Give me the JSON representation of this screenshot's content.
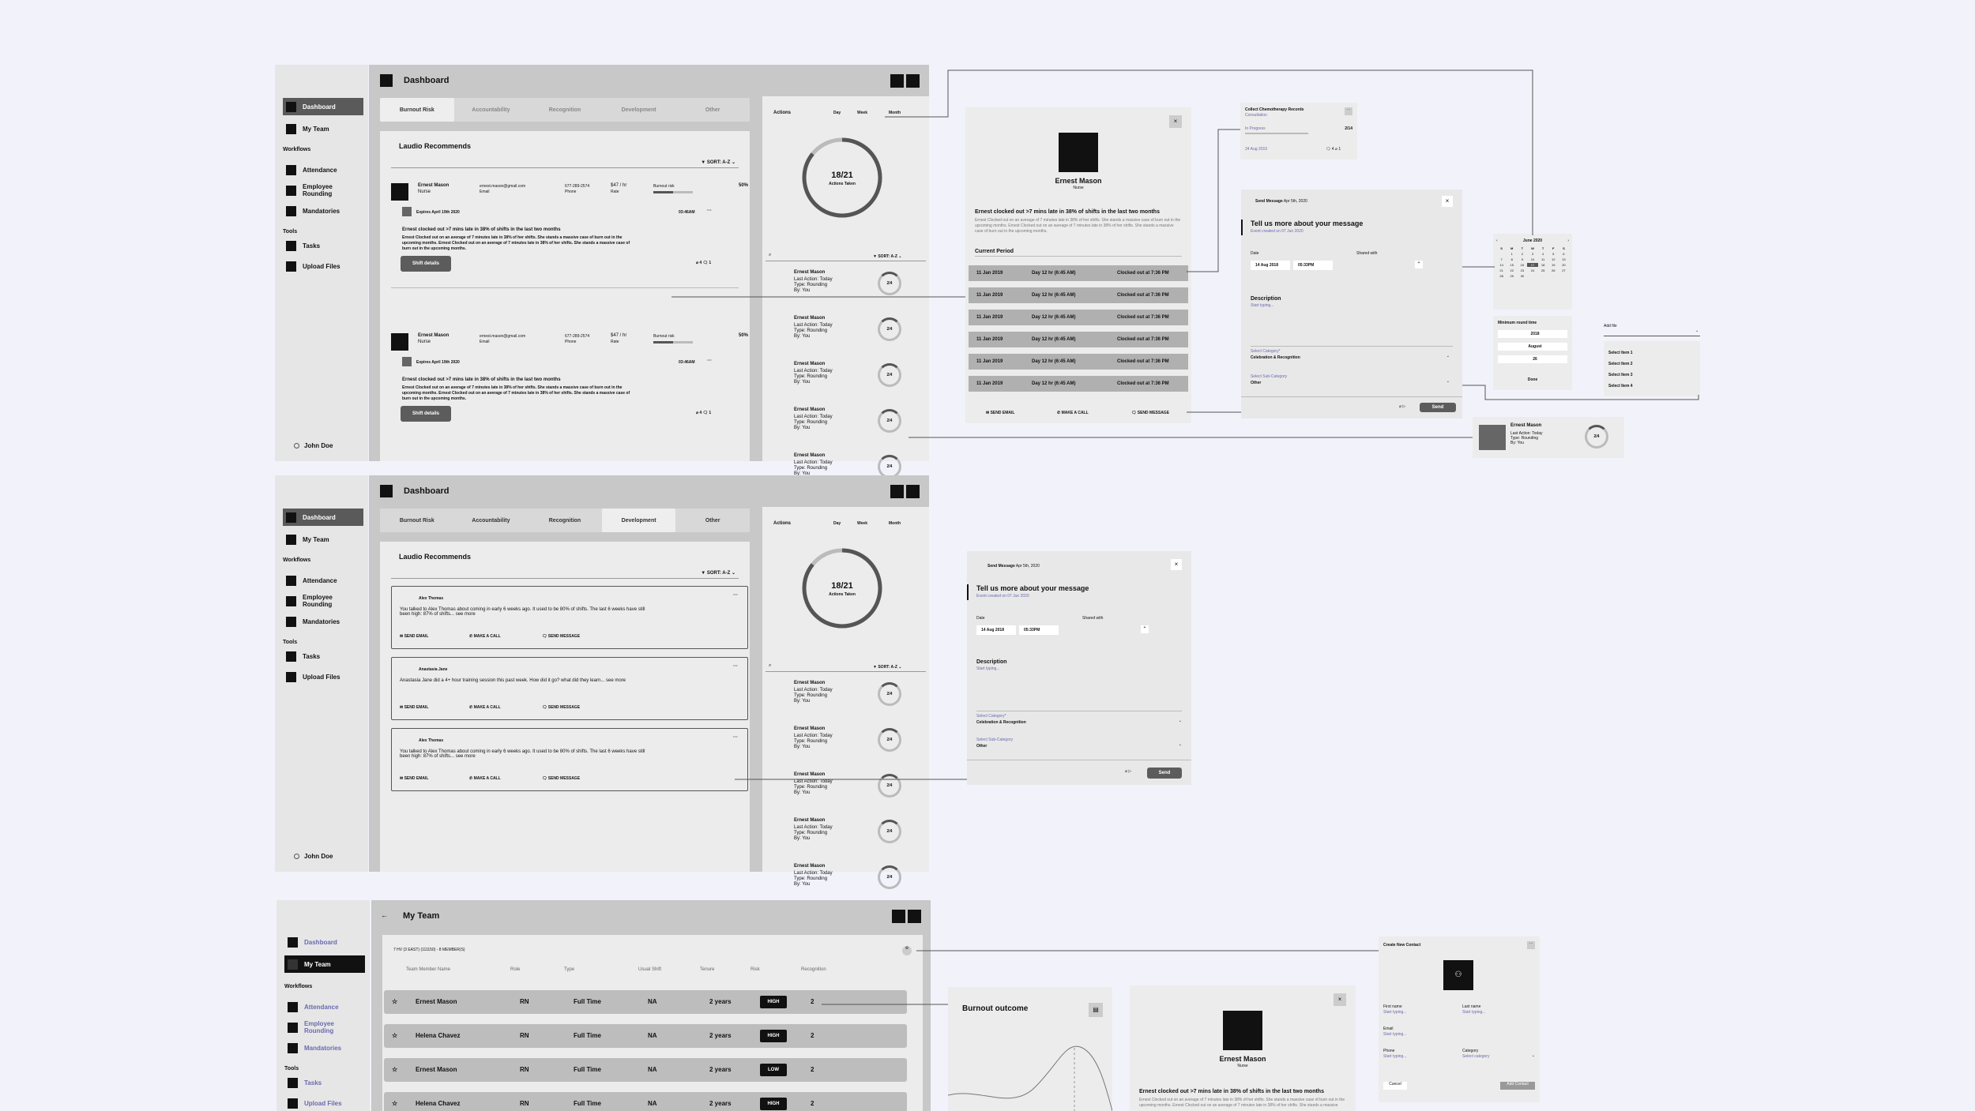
{
  "sidebar": {
    "dashboard": "Dashboard",
    "my_team": "My Team",
    "workflows": "Workflows",
    "attendance": "Attendance",
    "employee_rounding": "Employee Rounding",
    "mandatories": "Mandatories",
    "tools": "Tools",
    "tasks": "Tasks",
    "upload_files": "Upload Files",
    "user": "John Doe"
  },
  "dashboard": {
    "title": "Dashboard",
    "tabs": [
      "Burnout Risk",
      "Accountability",
      "Recognition",
      "Development",
      "Other"
    ],
    "panel_title": "Laudio Recommends",
    "sort": "SORT: A-Z"
  },
  "recommendation": {
    "name": "Ernest Mason",
    "role": "Nurse",
    "email": "ernest.mason@gmail.com",
    "email_label": "Email",
    "phone": "677-289-2574",
    "phone_label": "Phone",
    "rate": "$47 / hr",
    "rate_label": "Rate",
    "risk_label": "Burnout risk",
    "risk_value": "50%",
    "expires": "Expires April 19th 2020",
    "time": "03:46AM",
    "headline": "Ernest clocked out >7 mins late in 38% of shifts in the last two months",
    "body": "Ernest Clocked out on an average of 7 minutes late in 38% of her shifts. She stands a massive case of burn out in the upcoming months. Ernest Clocked out on an average of 7 minutes late in 38% of her shifts. She stands a massive case of burn out in the upcoming months.",
    "button": "Shift details",
    "attach_count": "4",
    "comment_count": "1"
  },
  "actions": {
    "title": "Actions",
    "ranges": [
      "Day",
      "Week",
      "Month"
    ],
    "count": "18/21",
    "count_label": "Actions Taken",
    "count_fraction": 0.857,
    "sort": "SORT: A-Z",
    "item_name": "Ernest Mason",
    "item_line1": "Last Action: Today",
    "item_line2": "Type: Rounding",
    "item_line3": "By: You",
    "item_ring": "2/4"
  },
  "profile": {
    "name": "Ernest Mason",
    "role": "Nurse",
    "headline": "Ernest clocked out >7 mins late in 38% of shifts in the last two months",
    "body": "Ernest Clocked out on an average of 7 minutes late in 38% of her shifts. She stands a massive case of burn out in the upcoming months. Ernest Clocked out on an average of 7 minutes late in 38% of her shifts. She stands a massive case of burn out in the upcoming months.",
    "period_title": "Current Period",
    "rows": [
      {
        "date": "11 Jan 2019",
        "shift": "Day 12 hr (6:45 AM)",
        "status": "Clocked out at 7:36 PM"
      },
      {
        "date": "11 Jan 2019",
        "shift": "Day 12 hr (6:45 AM)",
        "status": "Clocked out at 7:36 PM"
      },
      {
        "date": "11 Jan 2019",
        "shift": "Day 12 hr (6:45 AM)",
        "status": "Clocked out at 7:36 PM"
      },
      {
        "date": "11 Jan 2019",
        "shift": "Day 12 hr (6:45 AM)",
        "status": "Clocked out at 7:36 PM"
      },
      {
        "date": "11 Jan 2019",
        "shift": "Day 12 hr (6:45 AM)",
        "status": "Clocked out at 7:36 PM"
      },
      {
        "date": "11 Jan 2019",
        "shift": "Day 12 hr (6:45 AM)",
        "status": "Clocked out at 7:36 PM"
      }
    ],
    "send_email": "SEND EMAIL",
    "make_call": "MAKE A CALL",
    "send_message": "SEND MESSAGE"
  },
  "task_card": {
    "title": "Collect Chemotherapy Records",
    "subtitle": "Consultation",
    "status": "In Progress",
    "progress": "2/14",
    "date": "24 Aug 2019",
    "comments": "4",
    "attachments": "1"
  },
  "message": {
    "header": "Send Message",
    "header_date": "Apr 5th, 2020",
    "title": "Tell us more about your message",
    "created": "Event created on 07 Jun 2020",
    "date_label": "Date",
    "date_value": "14 Aug 2018",
    "time_value": "05:33PM",
    "shared_label": "Shared with",
    "desc_label": "Description",
    "desc_placeholder": "Start typing...",
    "category_label": "Select Category*",
    "category_value": "Celebration & Recognition",
    "subcategory_label": "Select Sub-Category",
    "subcategory_value": "Other",
    "send": "Send"
  },
  "calendar": {
    "month": "June 2020",
    "weekdays": [
      "S",
      "M",
      "T",
      "W",
      "T",
      "F",
      "S"
    ],
    "days": [
      "",
      "1",
      "2",
      "3",
      "4",
      "5",
      "6",
      "7",
      "8",
      "9",
      "10",
      "11",
      "12",
      "13",
      "14",
      "15",
      "16",
      "17",
      "18",
      "19",
      "20",
      "21",
      "22",
      "23",
      "24",
      "25",
      "26",
      "27",
      "28",
      "29",
      "30",
      "",
      "",
      "",
      ""
    ],
    "selected": "17",
    "time_title": "Minimum round time",
    "year": "2018",
    "month_word": "August",
    "day": "26",
    "done": "Done"
  },
  "dropdown": {
    "label": "Add file",
    "items": [
      "Select Item 1",
      "Select Item 2",
      "Select Item 3",
      "Select Item 4"
    ]
  },
  "mini_action": {
    "name": "Ernest Mason",
    "line1": "Last Action: Today",
    "line2": "Type: Rounding",
    "line3": "By: You",
    "ring": "2/4"
  },
  "development": {
    "items": [
      {
        "name": "Alex Thomas",
        "text": "You talked to Alex Thomas about coming in early 6 weeks ago. It used to be 80% of shifts. The last 6 weeks have still been high: 87% of shifts... see more"
      },
      {
        "name": "Anastasia Jane",
        "text": "Anastasia Jane did a 4+ hour training session this past week. How did it go? what did they learn... see more"
      },
      {
        "name": "Alex Thomas",
        "text": "You talked to Alex Thomas about coming in early 6 weeks ago. It used to be 80% of shifts. The last 6 weeks have still been high: 87% of shifts... see more"
      }
    ]
  },
  "team": {
    "title": "My Team",
    "group": "7 HV (3 EAST) (111150) - 8 MEMBER(S)",
    "columns": [
      "Team Member Name",
      "Role",
      "Type",
      "Usual Shift",
      "Tenure",
      "Risk",
      "Recognition"
    ],
    "rows": [
      {
        "name": "Ernest Mason",
        "role": "RN",
        "type": "Full Time",
        "shift": "NA",
        "tenure": "2 years",
        "risk": "HIGH",
        "recognition": "2"
      },
      {
        "name": "Helena Chavez",
        "role": "RN",
        "type": "Full Time",
        "shift": "NA",
        "tenure": "2 years",
        "risk": "HIGH",
        "recognition": "2"
      },
      {
        "name": "Ernest Mason",
        "role": "RN",
        "type": "Full Time",
        "shift": "NA",
        "tenure": "2 years",
        "risk": "LOW",
        "recognition": "2"
      },
      {
        "name": "Helena Chavez",
        "role": "RN",
        "type": "Full Time",
        "shift": "NA",
        "tenure": "2 years",
        "risk": "HIGH",
        "recognition": "2"
      }
    ]
  },
  "burnout": {
    "title": "Burnout outcome"
  },
  "contact": {
    "title": "Create New Contact",
    "first_name": "First name",
    "last_name": "Last name",
    "email": "Email",
    "phone": "Phone",
    "category": "Category",
    "placeholder": "Start typing...",
    "category_value": "Select category",
    "cancel": "Cancel",
    "add": "Add Contact"
  }
}
